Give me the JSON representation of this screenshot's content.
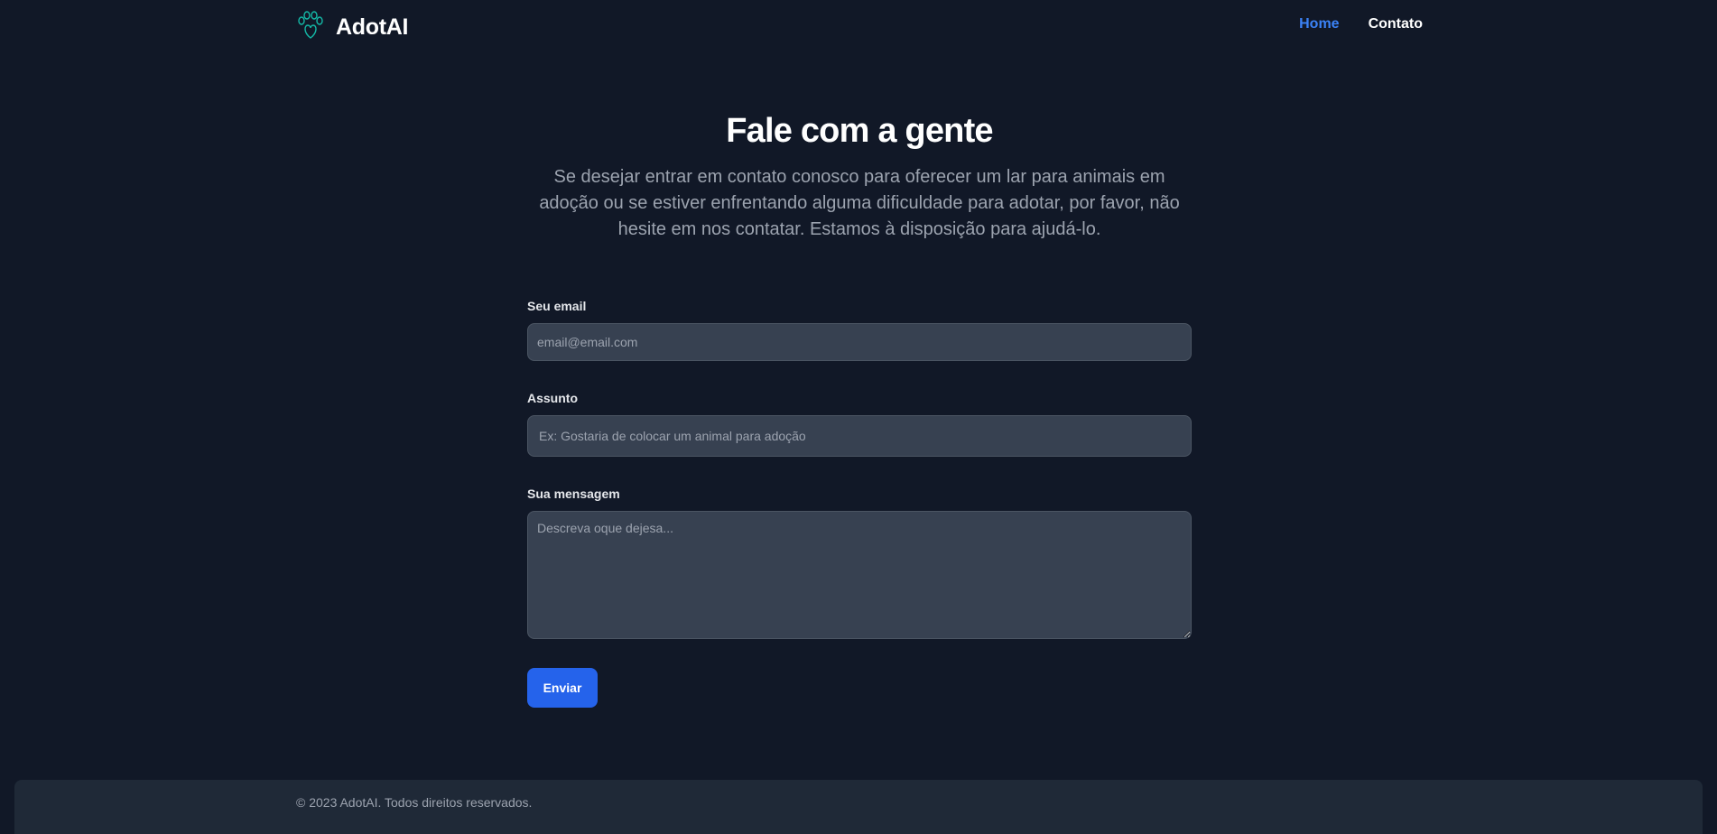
{
  "brand": {
    "name": "AdotAI",
    "logo_icon": "paw-heart-icon",
    "logo_color": "#14b8a6"
  },
  "nav": {
    "items": [
      {
        "label": "Home",
        "active": true
      },
      {
        "label": "Contato",
        "active": false
      }
    ],
    "active_color": "#3b82f6"
  },
  "hero": {
    "title": "Fale com a gente",
    "subtitle": "Se desejar entrar em contato conosco para oferecer um lar para animais em adoção ou se estiver enfrentando alguma dificuldade para adotar, por favor, não hesite em nos contatar. Estamos à disposição para ajudá-lo."
  },
  "form": {
    "email": {
      "label": "Seu email",
      "placeholder": "email@email.com",
      "value": ""
    },
    "subject": {
      "label": "Assunto",
      "placeholder": "Ex: Gostaria de colocar um animal para adoção",
      "value": ""
    },
    "message": {
      "label": "Sua mensagem",
      "placeholder": "Descreva oque dejesa...",
      "value": ""
    },
    "submit_label": "Enviar",
    "submit_color": "#2563eb"
  },
  "footer": {
    "text": "© 2023 AdotAI. Todos direitos reservados."
  }
}
